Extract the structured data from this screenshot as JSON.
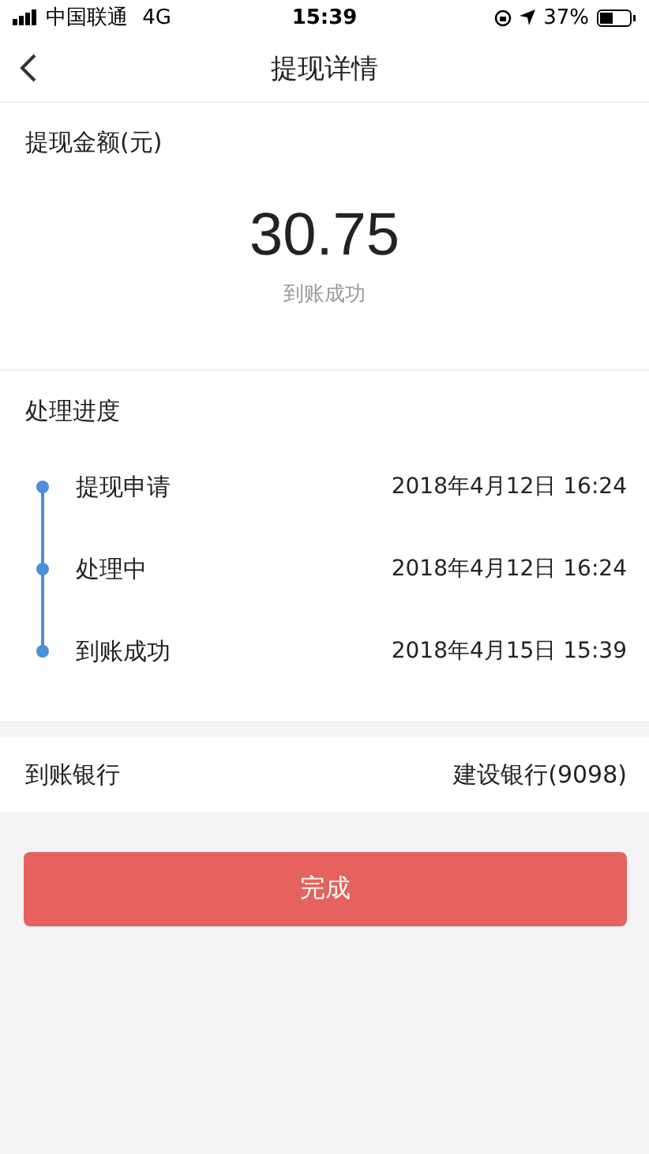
{
  "status_bar": {
    "carrier": "中国联通",
    "network": "4G",
    "time": "15:39",
    "battery": "37%"
  },
  "nav": {
    "title": "提现详情"
  },
  "amount": {
    "label": "提现金额(元)",
    "value": "30.75",
    "status": "到账成功"
  },
  "progress": {
    "title": "处理进度",
    "steps": [
      {
        "name": "提现申请",
        "time": "2018年4月12日 16:24"
      },
      {
        "name": "处理中",
        "time": "2018年4月12日 16:24"
      },
      {
        "name": "到账成功",
        "time": "2018年4月15日 15:39"
      }
    ]
  },
  "bank": {
    "label": "到账银行",
    "value": "建设银行(9098)"
  },
  "button": "完成"
}
